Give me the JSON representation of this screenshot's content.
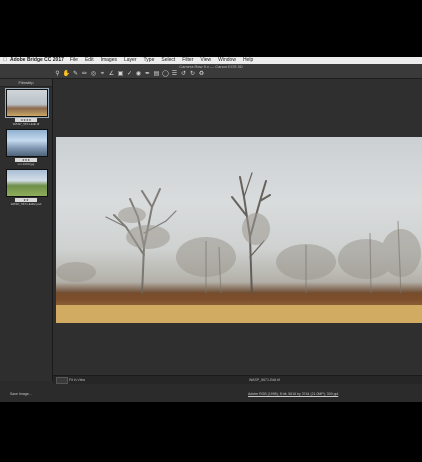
{
  "menubar": {
    "app_name": "Adobe Bridge CC 2017",
    "items": [
      "File",
      "Edit",
      "Images",
      "Layer",
      "Type",
      "Select",
      "Filter",
      "View",
      "Window",
      "Help"
    ]
  },
  "toolbar": {
    "title": "Camera Raw 9.x — Canon EOS 5D",
    "tools": [
      "zoom-icon",
      "hand-icon",
      "white-balance-icon",
      "color-sampler-icon",
      "target-adjust-icon",
      "crop-icon",
      "straighten-icon",
      "transform-icon",
      "spot-removal-icon",
      "red-eye-icon",
      "adjustment-brush-icon",
      "graduated-filter-icon",
      "radial-filter-icon",
      "preferences-icon",
      "rotate-ccw-icon",
      "rotate-cw-icon",
      "trash-icon"
    ]
  },
  "filmstrip": {
    "header": "Filmstrip",
    "thumbs": [
      {
        "stars": "★★★★",
        "filename": "WASP_5671-Edit.tif"
      },
      {
        "stars": "★★★",
        "filename": "nvr-1000.jpg"
      },
      {
        "stars": "★★",
        "filename": "WASP_5671-Edit2.psd"
      }
    ]
  },
  "status": {
    "zoom": "Fit in View",
    "filename": "WASP_5671-Edit.tif"
  },
  "footer": {
    "save_label": "Save Image...",
    "info_link": "Adobe RGB (1998); 8 bit; 5616 by 3744 (21.0MP); 300 ppi"
  },
  "colors": {
    "app_bg": "#2b2b2b",
    "menubar_bg": "#ececec",
    "ground": "#8a5a32",
    "grass": "#d1a95e"
  }
}
